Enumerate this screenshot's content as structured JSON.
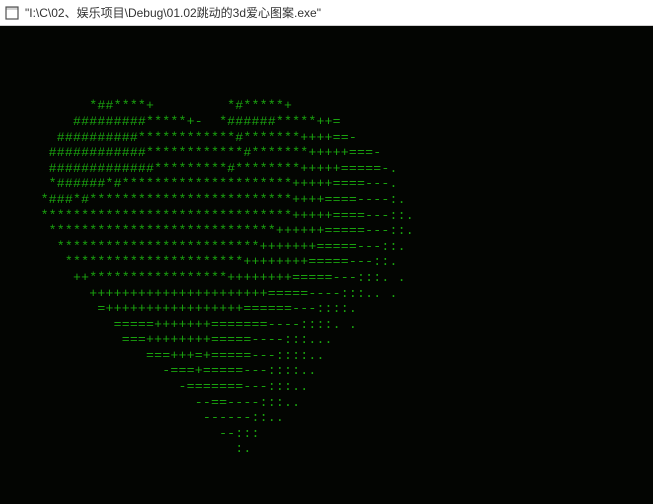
{
  "window": {
    "title": "\"I:\\C\\02、娱乐项目\\Debug\\01.02跳动的3d爱心图案.exe\""
  },
  "console": {
    "lines": [
      "",
      "",
      "",
      "",
      "           *##****+         *#*****+",
      "         #########*****+-  *######*****++=",
      "       ##########************#*******++++==-",
      "      ############************#*******+++++===-",
      "      #############*********#********+++++=====-.",
      "      *######*#*********************+++++====---.",
      "     *###*#*************************++++====----:.",
      "     *******************************+++++====---::.",
      "      ****************************++++++=====---::.",
      "       *************************+++++++=====---::.",
      "        **********************++++++++=====---::.",
      "         ++*****************++++++++=====---:::. .",
      "           ++++++++++++++++++++++=====----:::.. .",
      "            =+++++++++++++++++======---::::.",
      "              =====+++++++=======----::::. .",
      "               ===++++++++=====----:::...",
      "                  ===+++=+=====---::::..",
      "                    -===+=====---::::..",
      "                      -=======---:::..",
      "                        --==----:::..",
      "                         ------::..",
      "                           --:::",
      "                             :."
    ]
  }
}
